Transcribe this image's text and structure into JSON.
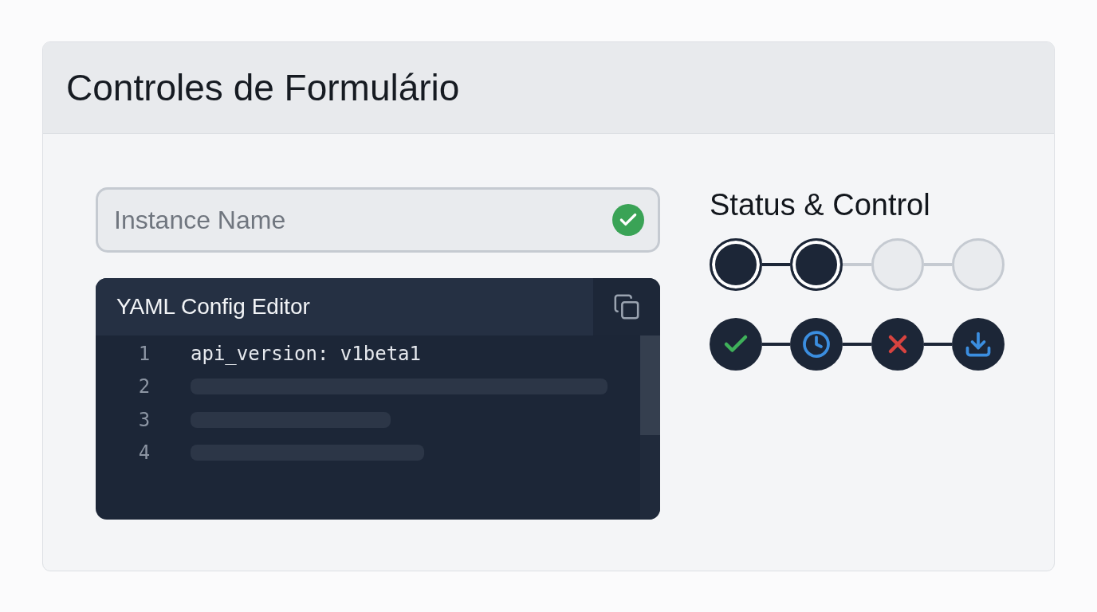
{
  "header": {
    "title": "Controles de Formulário"
  },
  "instance_field": {
    "placeholder": "Instance Name",
    "valid": true
  },
  "editor": {
    "title": "YAML Config Editor",
    "lines": [
      {
        "number": "1",
        "kind": "code",
        "code": "api_version: v1beta1"
      },
      {
        "number": "2",
        "kind": "skeleton"
      },
      {
        "number": "3",
        "kind": "skeleton"
      },
      {
        "number": "4",
        "kind": "skeleton"
      }
    ]
  },
  "status": {
    "title": "Status & Control",
    "steps": [
      {
        "completed": true
      },
      {
        "completed": true
      },
      {
        "completed": false
      },
      {
        "completed": false
      }
    ],
    "actions": [
      {
        "kind": "check"
      },
      {
        "kind": "clock"
      },
      {
        "kind": "cancel"
      },
      {
        "kind": "download"
      }
    ]
  }
}
